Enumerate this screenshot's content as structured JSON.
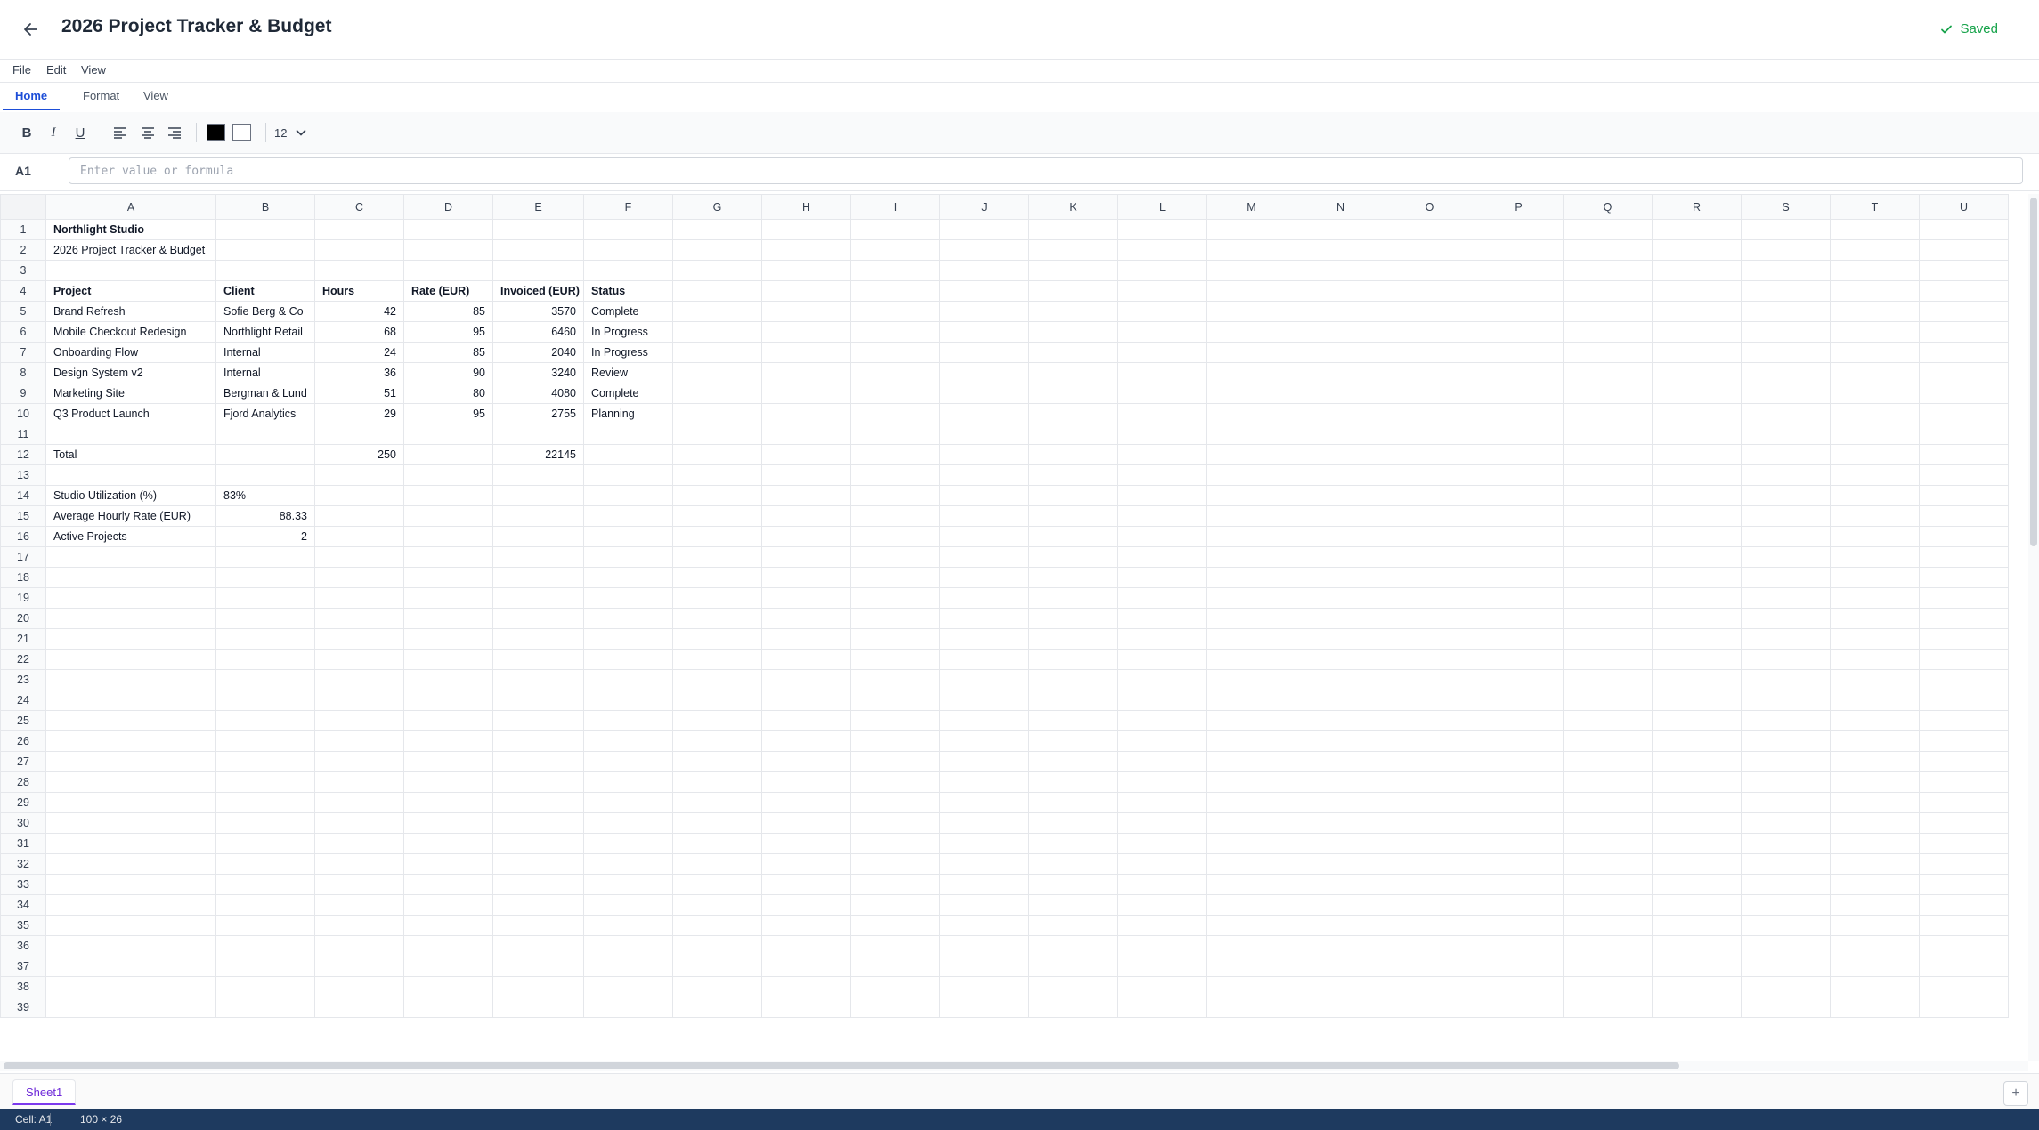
{
  "title": "2026 Project Tracker & Budget",
  "save_status": "Saved",
  "menu": [
    "File",
    "Edit",
    "View"
  ],
  "ribbon_tabs": [
    "Home",
    "Format",
    "View"
  ],
  "toolbar": {
    "bold": "B",
    "italic": "I",
    "underline": "U",
    "font_size": "12",
    "text_color": "#000000",
    "fill_color": "#ffffff"
  },
  "formula_bar": {
    "cell_ref": "A1",
    "value": "",
    "placeholder": "Enter value or formula"
  },
  "columns": [
    "A",
    "B",
    "C",
    "D",
    "E",
    "F",
    "G",
    "H",
    "I",
    "J",
    "K",
    "L",
    "M",
    "N",
    "O",
    "P",
    "Q",
    "R",
    "S",
    "T",
    "U"
  ],
  "row_count": 39,
  "cells": [
    {
      "row": 1,
      "col": "A",
      "text": "Northlight Studio",
      "bold": true
    },
    {
      "row": 2,
      "col": "A",
      "text": "2026 Project Tracker & Budget"
    },
    {
      "row": 4,
      "col": "A",
      "text": "Project",
      "bold": true
    },
    {
      "row": 4,
      "col": "B",
      "text": "Client",
      "bold": true
    },
    {
      "row": 4,
      "col": "C",
      "text": "Hours",
      "bold": true
    },
    {
      "row": 4,
      "col": "D",
      "text": "Rate (EUR)",
      "bold": true
    },
    {
      "row": 4,
      "col": "E",
      "text": "Invoiced (EUR)",
      "bold": true
    },
    {
      "row": 4,
      "col": "F",
      "text": "Status",
      "bold": true
    },
    {
      "row": 5,
      "col": "A",
      "text": "Brand Refresh"
    },
    {
      "row": 5,
      "col": "B",
      "text": "Sofie Berg & Co"
    },
    {
      "row": 5,
      "col": "C",
      "text": "42",
      "num": true
    },
    {
      "row": 5,
      "col": "D",
      "text": "85",
      "num": true
    },
    {
      "row": 5,
      "col": "E",
      "text": "3570",
      "num": true
    },
    {
      "row": 5,
      "col": "F",
      "text": "Complete"
    },
    {
      "row": 6,
      "col": "A",
      "text": "Mobile Checkout Redesign"
    },
    {
      "row": 6,
      "col": "B",
      "text": "Northlight Retail"
    },
    {
      "row": 6,
      "col": "C",
      "text": "68",
      "num": true
    },
    {
      "row": 6,
      "col": "D",
      "text": "95",
      "num": true
    },
    {
      "row": 6,
      "col": "E",
      "text": "6460",
      "num": true
    },
    {
      "row": 6,
      "col": "F",
      "text": "In Progress"
    },
    {
      "row": 7,
      "col": "A",
      "text": "Onboarding Flow"
    },
    {
      "row": 7,
      "col": "B",
      "text": "Internal"
    },
    {
      "row": 7,
      "col": "C",
      "text": "24",
      "num": true
    },
    {
      "row": 7,
      "col": "D",
      "text": "85",
      "num": true
    },
    {
      "row": 7,
      "col": "E",
      "text": "2040",
      "num": true
    },
    {
      "row": 7,
      "col": "F",
      "text": "In Progress"
    },
    {
      "row": 8,
      "col": "A",
      "text": "Design System v2"
    },
    {
      "row": 8,
      "col": "B",
      "text": "Internal"
    },
    {
      "row": 8,
      "col": "C",
      "text": "36",
      "num": true
    },
    {
      "row": 8,
      "col": "D",
      "text": "90",
      "num": true
    },
    {
      "row": 8,
      "col": "E",
      "text": "3240",
      "num": true
    },
    {
      "row": 8,
      "col": "F",
      "text": "Review"
    },
    {
      "row": 9,
      "col": "A",
      "text": "Marketing Site"
    },
    {
      "row": 9,
      "col": "B",
      "text": "Bergman & Lund"
    },
    {
      "row": 9,
      "col": "C",
      "text": "51",
      "num": true
    },
    {
      "row": 9,
      "col": "D",
      "text": "80",
      "num": true
    },
    {
      "row": 9,
      "col": "E",
      "text": "4080",
      "num": true
    },
    {
      "row": 9,
      "col": "F",
      "text": "Complete"
    },
    {
      "row": 10,
      "col": "A",
      "text": "Q3 Product Launch"
    },
    {
      "row": 10,
      "col": "B",
      "text": "Fjord Analytics"
    },
    {
      "row": 10,
      "col": "C",
      "text": "29",
      "num": true
    },
    {
      "row": 10,
      "col": "D",
      "text": "95",
      "num": true
    },
    {
      "row": 10,
      "col": "E",
      "text": "2755",
      "num": true
    },
    {
      "row": 10,
      "col": "F",
      "text": "Planning"
    },
    {
      "row": 12,
      "col": "A",
      "text": "Total"
    },
    {
      "row": 12,
      "col": "C",
      "text": "250",
      "num": true
    },
    {
      "row": 12,
      "col": "E",
      "text": "22145",
      "num": true
    },
    {
      "row": 14,
      "col": "A",
      "text": "Studio Utilization (%)"
    },
    {
      "row": 14,
      "col": "B",
      "text": "83%"
    },
    {
      "row": 15,
      "col": "A",
      "text": "Average Hourly Rate (EUR)"
    },
    {
      "row": 15,
      "col": "B",
      "text": "88.33",
      "num": true
    },
    {
      "row": 16,
      "col": "A",
      "text": "Active Projects"
    },
    {
      "row": 16,
      "col": "B",
      "text": "2",
      "num": true
    }
  ],
  "sheets": [
    "Sheet1"
  ],
  "add_sheet_label": "+",
  "status": {
    "cell": "Cell: A1",
    "dims": "100 × 26"
  },
  "colors": {
    "accent": "#1d4ed8",
    "saved": "#16a34a",
    "sheet_tab": "#7c3aed",
    "status_bar": "#1e3a5f"
  }
}
